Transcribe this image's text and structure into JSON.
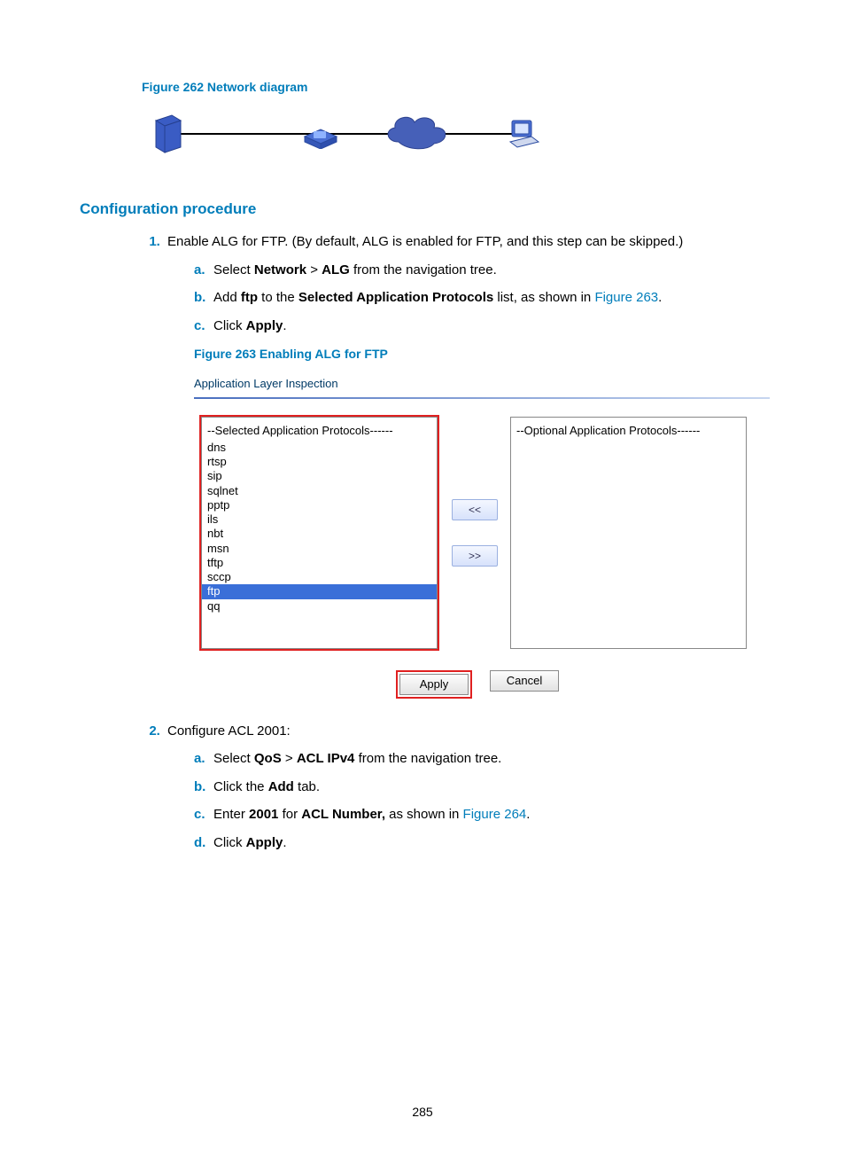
{
  "figure262_caption": "Figure 262 Network diagram",
  "config_heading": "Configuration procedure",
  "step1": {
    "text": "Enable ALG for FTP. (By default, ALG is enabled for FTP, and this step can be skipped.)",
    "a_pre": "Select ",
    "a_b1": "Network",
    "a_mid": " > ",
    "a_b2": "ALG",
    "a_post": " from the navigation tree.",
    "b_pre": "Add ",
    "b_b1": "ftp",
    "b_mid": " to the ",
    "b_b2": "Selected Application Protocols",
    "b_post1": " list, as shown in ",
    "b_link": "Figure 263",
    "b_post2": ".",
    "c_pre": "Click ",
    "c_b1": "Apply",
    "c_post": "."
  },
  "figure263_caption": "Figure 263 Enabling ALG for FTP",
  "embed": {
    "title": "Application Layer Inspection",
    "left_header": "--Selected Application Protocols------",
    "left_items": [
      "dns",
      "rtsp",
      "sip",
      "sqlnet",
      "pptp",
      "ils",
      "nbt",
      "msn",
      "tftp",
      "sccp"
    ],
    "left_selected": "ftp",
    "left_after": [
      "qq"
    ],
    "right_header": "--Optional Application Protocols------",
    "move_left": "<<",
    "move_right": ">>",
    "apply": "Apply",
    "cancel": "Cancel"
  },
  "step2": {
    "text": "Configure ACL 2001:",
    "a_pre": "Select ",
    "a_b1": "QoS",
    "a_mid": " > ",
    "a_b2": "ACL IPv4",
    "a_post": " from the navigation tree.",
    "b_pre": "Click the ",
    "b_b1": "Add",
    "b_post": " tab.",
    "c_pre": "Enter ",
    "c_b1": "2001",
    "c_mid": " for ",
    "c_b2": "ACL Number,",
    "c_post1": " as shown in ",
    "c_link": "Figure 264",
    "c_post2": ".",
    "d_pre": "Click ",
    "d_b1": "Apply",
    "d_post": "."
  },
  "alpha": {
    "a": "a.",
    "b": "b.",
    "c": "c.",
    "d": "d."
  },
  "page_number": "285"
}
